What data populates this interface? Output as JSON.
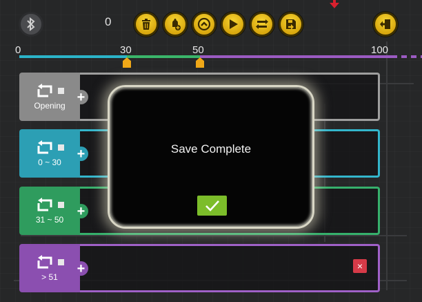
{
  "toolbar": {
    "counter": "0",
    "buttons": [
      {
        "name": "delete",
        "icon": "trash-icon"
      },
      {
        "name": "add-bell",
        "icon": "bell-add-icon"
      },
      {
        "name": "up",
        "icon": "chevron-up-icon"
      },
      {
        "name": "play",
        "icon": "play-icon"
      },
      {
        "name": "shuffle",
        "icon": "shuffle-icon"
      },
      {
        "name": "save",
        "icon": "save-icon"
      },
      {
        "name": "exit",
        "icon": "exit-icon"
      }
    ],
    "accent": "#f2c21b"
  },
  "slider": {
    "ticks": [
      "0",
      "30",
      "50",
      "100"
    ],
    "handles": [
      30,
      50
    ],
    "range_max": 100,
    "colors": {
      "segment_a": "#2bb3c8",
      "segment_b": "#3ab56a",
      "segment_c": "#9b5bc2"
    }
  },
  "rows": [
    {
      "label": "Opening",
      "color": "#8a8a8a",
      "border": "#9e9e9e"
    },
    {
      "label": "0 ~ 30",
      "color": "#2c9fb4",
      "border": "#33b6cc"
    },
    {
      "label": "31 ~ 50",
      "color": "#2f9c5e",
      "border": "#36b06c"
    },
    {
      "label": "> 51",
      "color": "#8b4fb0",
      "border": "#a061c8"
    }
  ],
  "dialog": {
    "message": "Save Complete",
    "confirm_icon": "checkmark-icon",
    "confirm_color": "#7cbd2a"
  },
  "delete_row_label": "×"
}
